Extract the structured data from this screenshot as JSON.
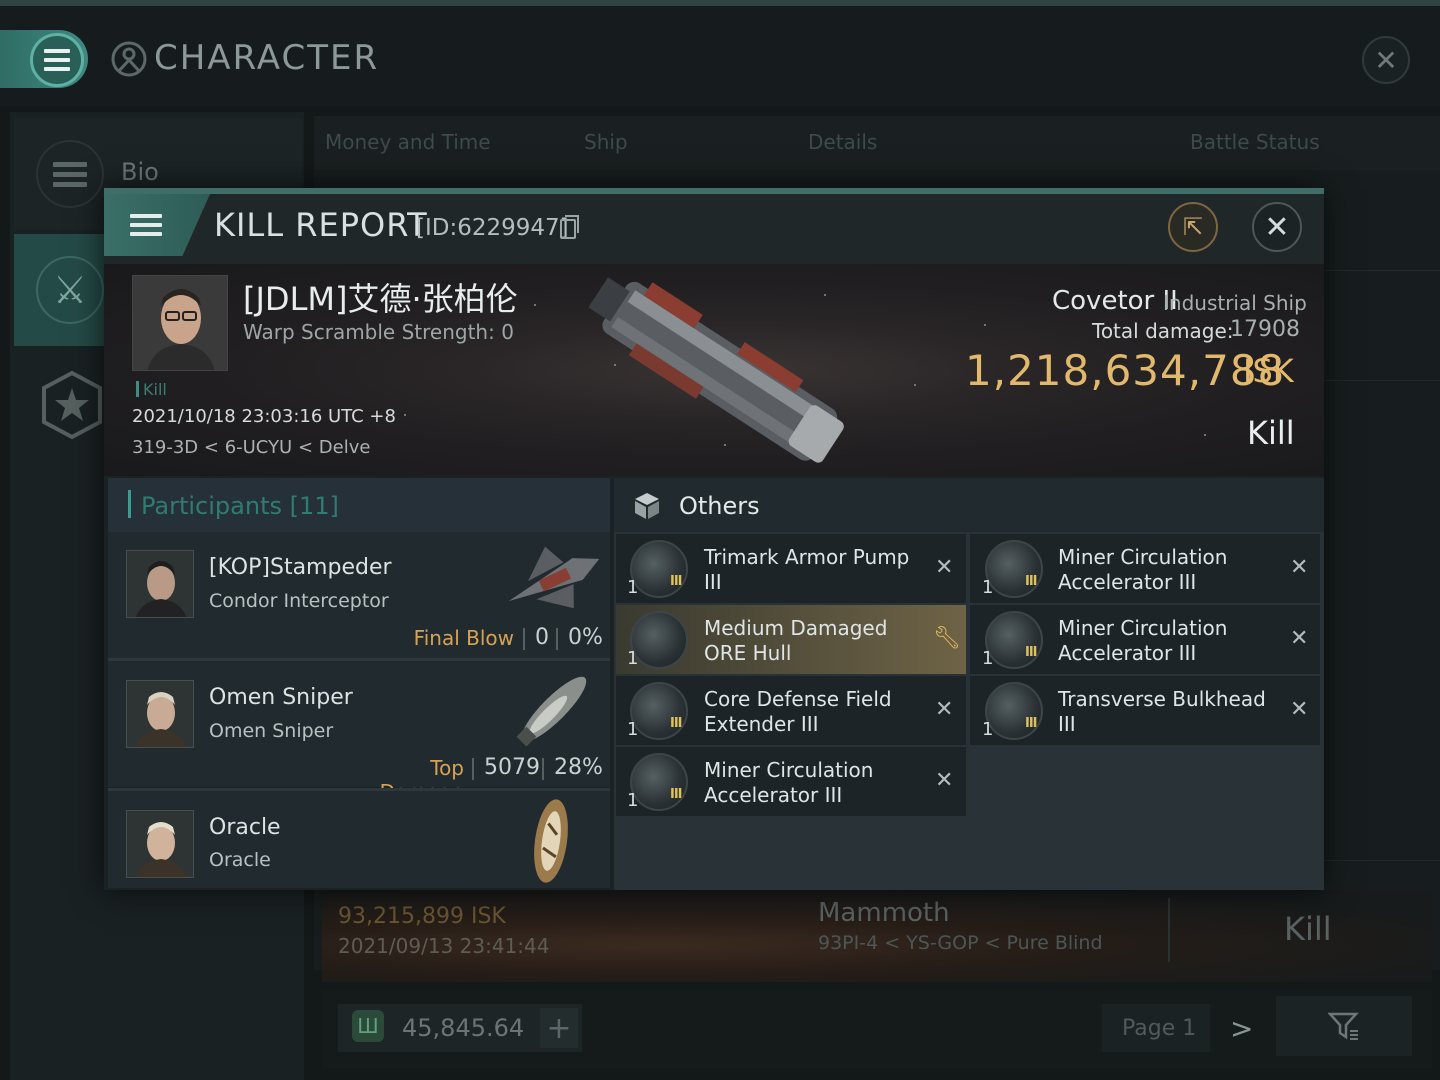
{
  "window": {
    "title": "CHARACTER",
    "sidebar": {
      "bio_label": "Bio"
    },
    "tabs": [
      "Money and Time",
      "Ship",
      "Details",
      "Battle Status"
    ]
  },
  "background_row": {
    "isk": "93,215,899 ISK",
    "date": "2021/09/13  23:41:44",
    "ship": "Mammoth",
    "location": "93PI-4 < YS-GOP < Pure Blind",
    "type": "Kill"
  },
  "footer": {
    "wallet": "45,845.64",
    "page": "Page 1"
  },
  "kill_report": {
    "title": "KILL REPORT",
    "id": "[ID:6229947]",
    "victim": {
      "name": "[JDLM]艾德·张柏伦",
      "scramble": "Warp Scramble Strength: 0",
      "tag": "Kill",
      "datetime": "2021/10/18 23:03:16 UTC +8",
      "location": "319-3D < 6-UCYU < Delve",
      "ship_name": "Covetor II",
      "ship_class": "Industrial Ship",
      "damage_label": "Total damage:",
      "damage_value": "17908",
      "value": "1,218,634,788",
      "value_unit": "ISK",
      "type": "Kill"
    },
    "participants": {
      "title": "Participants [11]",
      "rows": [
        {
          "name": "[KOP]Stampeder",
          "ship": "Condor Interceptor",
          "role": "Final Blow",
          "damage": "0",
          "percent": "0%"
        },
        {
          "name": "Omen Sniper",
          "ship": "Omen Sniper",
          "role": "Top Damage",
          "damage": "5079",
          "percent": "28%"
        },
        {
          "name": "Oracle",
          "ship": "Oracle",
          "role": "",
          "damage": "",
          "percent": ""
        }
      ]
    },
    "items": {
      "title": "Others",
      "list": [
        {
          "qty": "1",
          "tier": "III",
          "name": "Trimark Armor Pump III",
          "status": "destroyed",
          "icon": "armor-rig-icon"
        },
        {
          "qty": "1",
          "tier": "III",
          "name": "Miner Circulation Accelerator III",
          "status": "destroyed",
          "icon": "mining-rig-icon"
        },
        {
          "qty": "1",
          "tier": "",
          "name": "Medium Damaged ORE Hull",
          "status": "dropped",
          "icon": "hull-icon"
        },
        {
          "qty": "1",
          "tier": "III",
          "name": "Miner Circulation Accelerator III",
          "status": "destroyed",
          "icon": "mining-rig-icon"
        },
        {
          "qty": "1",
          "tier": "III",
          "name": "Core Defense Field Extender III",
          "status": "destroyed",
          "icon": "shield-rig-icon"
        },
        {
          "qty": "1",
          "tier": "III",
          "name": "Transverse Bulkhead III",
          "status": "destroyed",
          "icon": "armor-rig-icon"
        },
        {
          "qty": "1",
          "tier": "III",
          "name": "Miner Circulation Accelerator III",
          "status": "destroyed",
          "icon": "mining-rig-icon"
        }
      ]
    }
  }
}
